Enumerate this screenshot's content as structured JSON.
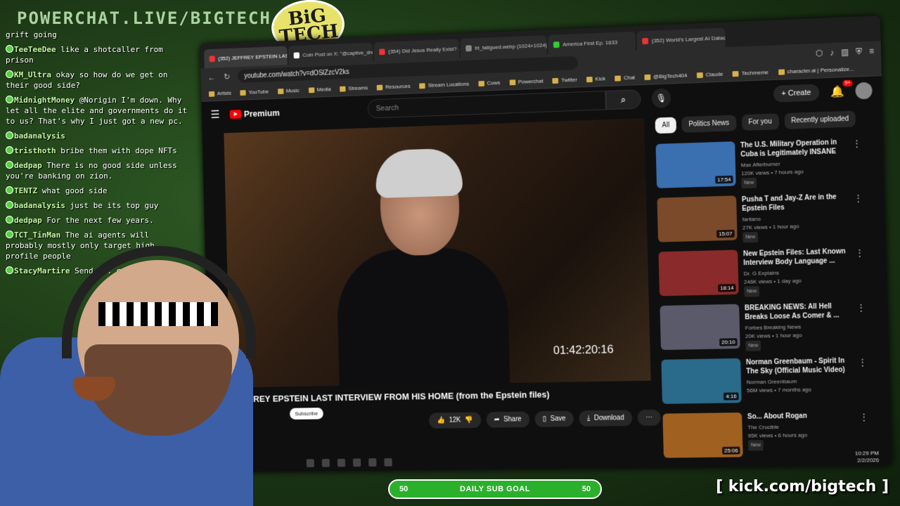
{
  "overlay": {
    "stream_title": "POWERCHAT.LIVE/BIGTECH",
    "logo_text": "BiG TECH",
    "kick_link": "[ kick.com/bigtech ]",
    "sub_goal": {
      "left": "50",
      "label": "DAILY SUB GOAL",
      "right": "50"
    }
  },
  "chat": [
    {
      "user": "",
      "text": "grift going"
    },
    {
      "user": "TeeTeeDee",
      "text": "like a shotcaller from prison"
    },
    {
      "user": "KM_Ultra",
      "text": "okay so how do we get on their good side?"
    },
    {
      "user": "MidnightMoney",
      "text": "@Norigin I'm down. Why let all the elite and governments do it to us? That's why I just got a new pc."
    },
    {
      "user": "badanalysis",
      "text": ""
    },
    {
      "user": "tristhoth",
      "text": "bribe them with dope NFTs"
    },
    {
      "user": "dedpap",
      "text": "There is no good side unless you're banking on zion."
    },
    {
      "user": "TENTZ",
      "text": "what good side"
    },
    {
      "user": "badanalysis",
      "text": "just be its top guy"
    },
    {
      "user": "dedpap",
      "text": "For the next few years."
    },
    {
      "user": "TCT_TinMan",
      "text": "The ai agents will probably mostly only target high profile people"
    },
    {
      "user": "StacyMartire",
      "text": "Send ... good luck!!"
    }
  ],
  "browser": {
    "tabs": [
      {
        "label": "(352) JEFFREY EPSTEIN LAST INTERV",
        "active": true
      },
      {
        "label": "Coin Post on X: \"@captive_dreamer The",
        "active": false
      },
      {
        "label": "(354) Did Jesus Really Exist? - YouTube",
        "active": false
      },
      {
        "label": "bt_fatigued.webp (1024×1024)",
        "active": false
      },
      {
        "label": "America First Ep. 1633",
        "active": false
      },
      {
        "label": "(352) World's Largest AI Datacenter Has",
        "active": false
      }
    ],
    "url": "youtube.com/watch?v=dOSlZzcV2ks",
    "bookmarks": [
      "Artists",
      "YouTube",
      "Music",
      "Media",
      "Streams",
      "Resources",
      "Stream Locations",
      "Cows",
      "Powerchat",
      "Twitter",
      "Kick",
      "Chat",
      "@BigTech404",
      "Claude",
      "Techmeme",
      "character.ai | Personalize..."
    ]
  },
  "yt": {
    "logo": "Premium",
    "search_placeholder": "Search",
    "create_label": "Create",
    "notif_count": "9+",
    "timecode": "01:42:20:16",
    "video_title": "JEFFREY EPSTEIN LAST INTERVIEW FROM HIS HOME (from the Epstein files)",
    "subscribe": "Subscribe",
    "actions": {
      "likes": "12K",
      "share": "Share",
      "save": "Save",
      "download": "Download"
    },
    "chips": [
      "All",
      "Politics News",
      "For you",
      "Recently uploaded"
    ],
    "recs": [
      {
        "title": "The U.S. Military Operation in Cuba is Legitimately INSANE",
        "channel": "Max Afterburner",
        "meta": "120K views • 7 hours ago",
        "badge": "New",
        "duration": "17:54",
        "color": "#3a6fb0"
      },
      {
        "title": "Pusha T and Jay-Z Are in the Epstein Files",
        "channel": "fantano",
        "meta": "27K views • 1 hour ago",
        "badge": "New",
        "duration": "15:07",
        "color": "#7a4a2a"
      },
      {
        "title": "New Epstein Files: Last Known Interview Body Language ...",
        "channel": "Dr. G Explains",
        "meta": "246K views • 1 day ago",
        "badge": "New",
        "duration": "18:14",
        "color": "#8a2a2a"
      },
      {
        "title": "BREAKING NEWS: All Hell Breaks Loose As Comer & ...",
        "channel": "Forbes Breaking News",
        "meta": "20K views • 1 hour ago",
        "badge": "New",
        "duration": "20:10",
        "color": "#5a5a6a"
      },
      {
        "title": "Norman Greenbaum - Spirit In The Sky (Official Music Video)",
        "channel": "Norman Greenbaum",
        "meta": "56M views • 7 months ago",
        "badge": "",
        "duration": "4:16",
        "color": "#2a6a8a"
      },
      {
        "title": "So... About Rogan",
        "channel": "The Crucible",
        "meta": "95K views • 6 hours ago",
        "badge": "New",
        "duration": "25:06",
        "color": "#a06020"
      }
    ],
    "clock": {
      "time": "10:29 PM",
      "date": "2/2/2026"
    }
  }
}
